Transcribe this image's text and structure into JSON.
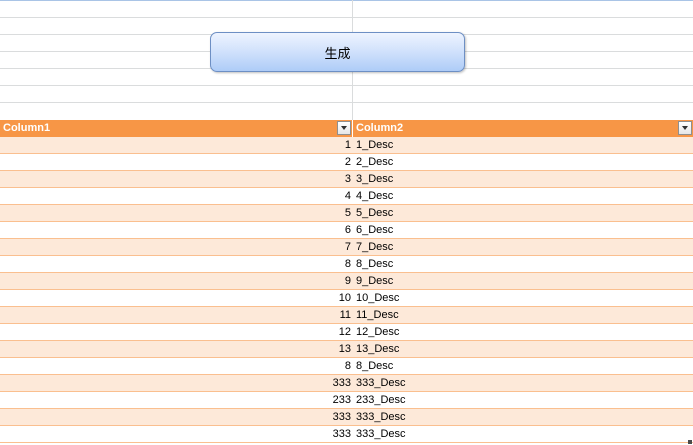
{
  "button": {
    "label": "生成"
  },
  "table": {
    "columns": [
      "Column1",
      "Column2"
    ],
    "rows": [
      {
        "c1": "1",
        "c2": "1_Desc"
      },
      {
        "c1": "2",
        "c2": "2_Desc"
      },
      {
        "c1": "3",
        "c2": "3_Desc"
      },
      {
        "c1": "4",
        "c2": "4_Desc"
      },
      {
        "c1": "5",
        "c2": "5_Desc"
      },
      {
        "c1": "6",
        "c2": "6_Desc"
      },
      {
        "c1": "7",
        "c2": "7_Desc"
      },
      {
        "c1": "8",
        "c2": "8_Desc"
      },
      {
        "c1": "9",
        "c2": "9_Desc"
      },
      {
        "c1": "10",
        "c2": "10_Desc"
      },
      {
        "c1": "11",
        "c2": "11_Desc"
      },
      {
        "c1": "12",
        "c2": "12_Desc"
      },
      {
        "c1": "13",
        "c2": "13_Desc"
      },
      {
        "c1": "8",
        "c2": "8_Desc"
      },
      {
        "c1": "333",
        "c2": "333_Desc"
      },
      {
        "c1": "233",
        "c2": "233_Desc"
      },
      {
        "c1": "333",
        "c2": "333_Desc"
      },
      {
        "c1": "333",
        "c2": "333_Desc"
      }
    ]
  },
  "icons": {
    "filter": "filter-dropdown-icon",
    "resize": "table-resize-handle-icon"
  },
  "colors": {
    "header_bg": "#f79646",
    "band_bg": "#fde9d9",
    "row_border": "#fabf8f",
    "button_gradient_bottom": "#aeccf7"
  }
}
